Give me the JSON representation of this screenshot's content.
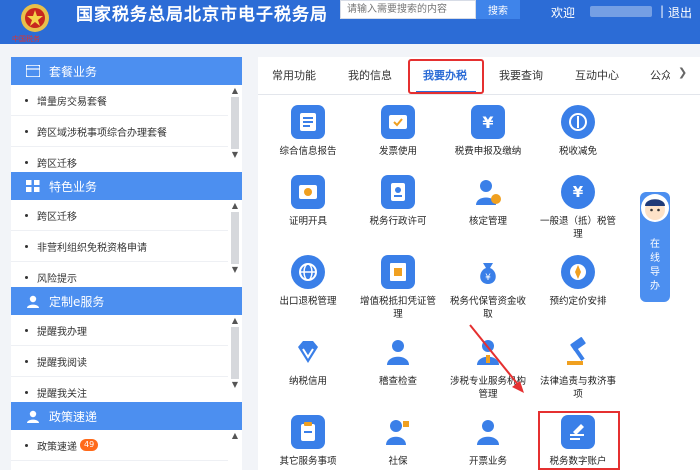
{
  "header": {
    "site_title": "国家税务总局北京市电子税务局",
    "logo_caption": "中国税务",
    "search_placeholder": "请输入需要搜索的内容",
    "search_button": "搜索",
    "welcome": "欢迎",
    "separator": "|",
    "logout": "退出",
    "bg_color": "#2c6cd6"
  },
  "sidebar": {
    "sections": [
      {
        "title": "套餐业务",
        "icon": "grid-icon",
        "items": [
          "增量房交易套餐",
          "跨区域涉税事项综合办理套餐",
          "跨区迁移"
        ]
      },
      {
        "title": "特色业务",
        "icon": "grid-icon",
        "items": [
          "跨区迁移",
          "非营利组织免税资格申请",
          "风险提示"
        ]
      },
      {
        "title": "定制e服务",
        "icon": "user-icon",
        "items": [
          "提醒我办理",
          "提醒我阅读",
          "提醒我关注"
        ]
      },
      {
        "title": "政策速递",
        "icon": "user-icon",
        "items": [
          "政策速递"
        ],
        "badge": "49"
      }
    ]
  },
  "tabs": [
    {
      "label": "常用功能"
    },
    {
      "label": "我的信息"
    },
    {
      "label": "我要办税",
      "active": true
    },
    {
      "label": "我要查询"
    },
    {
      "label": "互动中心"
    },
    {
      "label": "公众服务"
    }
  ],
  "tiles": [
    {
      "label": "综合信息报告",
      "icon": "report-icon"
    },
    {
      "label": "发票使用",
      "icon": "invoice-icon"
    },
    {
      "label": "税费申报及缴纳",
      "icon": "yuan-declare-icon"
    },
    {
      "label": "税收减免",
      "icon": "tax-relief-icon"
    },
    {
      "label": "证明开具",
      "icon": "certificate-icon"
    },
    {
      "label": "税务行政许可",
      "icon": "license-icon"
    },
    {
      "label": "核定管理",
      "icon": "person-verify-icon"
    },
    {
      "label": "一般退（抵）税管理",
      "icon": "refund-icon"
    },
    {
      "label": "出口退税管理",
      "icon": "globe-icon"
    },
    {
      "label": "增值税抵扣凭证管理",
      "icon": "vat-voucher-icon"
    },
    {
      "label": "税务代保管资金收取",
      "icon": "money-bag-icon"
    },
    {
      "label": "预约定价安排",
      "icon": "compass-icon"
    },
    {
      "label": "纳税信用",
      "icon": "diamond-icon"
    },
    {
      "label": "稽查检查",
      "icon": "inspector-icon"
    },
    {
      "label": "涉税专业服务机构管理",
      "icon": "agency-icon"
    },
    {
      "label": "法律追责与救济事项",
      "icon": "gavel-icon"
    },
    {
      "label": "其它服务事项",
      "icon": "clipboard-icon"
    },
    {
      "label": "社保",
      "icon": "social-security-icon"
    },
    {
      "label": "开票业务",
      "icon": "invoice-person-icon"
    },
    {
      "label": "税务数字账户",
      "icon": "digital-account-icon"
    }
  ],
  "online_help": {
    "label_lines": [
      "在",
      "线",
      "导",
      "办"
    ]
  },
  "colors": {
    "accent": "#2c6cd6",
    "section_head": "#4c8ff0",
    "highlight": "#e53030"
  }
}
